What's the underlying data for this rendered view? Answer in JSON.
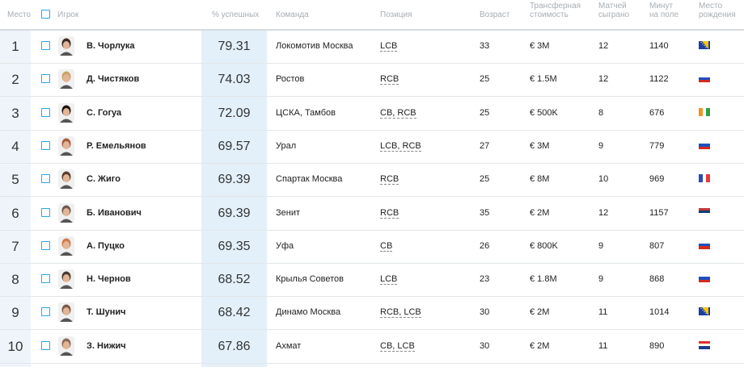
{
  "headers": {
    "rank": "Место",
    "player": "Игрок",
    "pct": "% успешных",
    "team": "Команда",
    "position": "Позиция",
    "age": "Возраст",
    "value_l1": "Трансферная",
    "value_l2": "стоимость",
    "matches_l1": "Матчей",
    "matches_l2": "сыграно",
    "minutes_l1": "Минут",
    "minutes_l2": "на поле",
    "birth_l1": "Место",
    "birth_l2": "рождения"
  },
  "rows": [
    {
      "rank": "1",
      "name": "В. Чорлука",
      "pct": "79.31",
      "team": "Локомотив Москва",
      "pos": "LCB",
      "age": "33",
      "value": "€ 3M",
      "matches": "12",
      "minutes": "1140",
      "flag": "bosnia",
      "avatar": "#3b2a22"
    },
    {
      "rank": "2",
      "name": "Д. Чистяков",
      "pct": "74.03",
      "team": "Ростов",
      "pos": "RCB",
      "age": "25",
      "value": "€ 1.5M",
      "matches": "12",
      "minutes": "1122",
      "flag": "russia",
      "avatar": "#c9a467"
    },
    {
      "rank": "3",
      "name": "С. Гогуа",
      "pct": "72.09",
      "team": "ЦСКА, Тамбов",
      "pos": "CB, RCB",
      "age": "25",
      "value": "€ 500K",
      "matches": "8",
      "minutes": "676",
      "flag": "ivory-coast",
      "avatar": "#1e1410"
    },
    {
      "rank": "4",
      "name": "Р. Емельянов",
      "pct": "69.57",
      "team": "Урал",
      "pos": "LCB, RCB",
      "age": "27",
      "value": "€ 3M",
      "matches": "9",
      "minutes": "779",
      "flag": "russia",
      "avatar": "#a55a3c"
    },
    {
      "rank": "5",
      "name": "С. Жиго",
      "pct": "69.39",
      "team": "Спартак Москва",
      "pos": "RCB",
      "age": "25",
      "value": "€ 8M",
      "matches": "10",
      "minutes": "969",
      "flag": "france",
      "avatar": "#5a3b2c"
    },
    {
      "rank": "6",
      "name": "Б. Иванович",
      "pct": "69.39",
      "team": "Зенит",
      "pos": "RCB",
      "age": "35",
      "value": "€ 2M",
      "matches": "12",
      "minutes": "1157",
      "flag": "serbia",
      "avatar": "#6e5a4e"
    },
    {
      "rank": "7",
      "name": "А. Пуцко",
      "pct": "69.35",
      "team": "Уфа",
      "pos": "CB",
      "age": "26",
      "value": "€ 800K",
      "matches": "9",
      "minutes": "807",
      "flag": "russia",
      "avatar": "#d07a4a"
    },
    {
      "rank": "8",
      "name": "Н. Чернов",
      "pct": "68.52",
      "team": "Крылья Советов",
      "pos": "LCB",
      "age": "23",
      "value": "€ 1.8M",
      "matches": "9",
      "minutes": "868",
      "flag": "russia",
      "avatar": "#4a3a30"
    },
    {
      "rank": "9",
      "name": "Т. Шунич",
      "pct": "68.42",
      "team": "Динамо Москва",
      "pos": "RCB, LCB",
      "age": "30",
      "value": "€ 2M",
      "matches": "11",
      "minutes": "1014",
      "flag": "bosnia",
      "avatar": "#7a5a48"
    },
    {
      "rank": "10",
      "name": "З. Нижич",
      "pct": "67.86",
      "team": "Ахмат",
      "pos": "CB, LCB",
      "age": "30",
      "value": "€ 2M",
      "matches": "11",
      "minutes": "890",
      "flag": "croatia",
      "avatar": "#8a6a58"
    }
  ]
}
